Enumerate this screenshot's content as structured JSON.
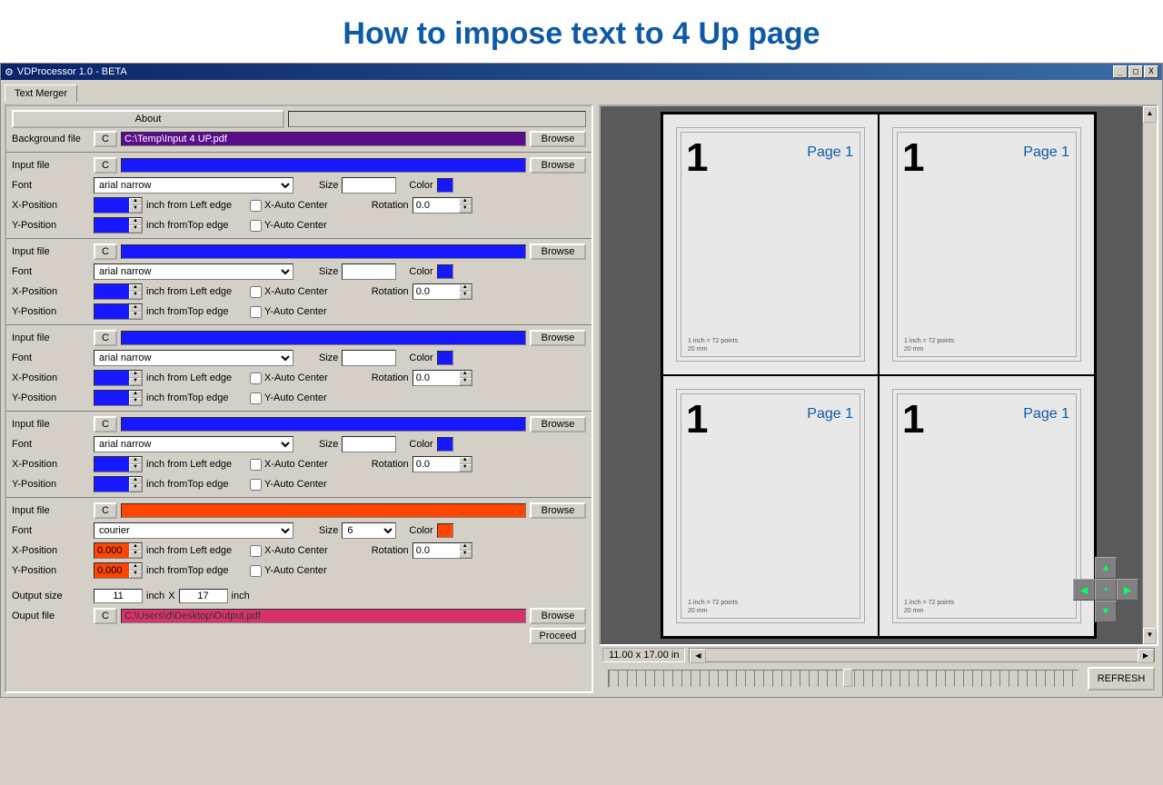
{
  "page_heading": "How to impose text to 4 Up page",
  "window_title": "VDProcessor 1.0 - BETA",
  "tab": "Text Merger",
  "about_label": "About",
  "browse_label": "Browse",
  "c_label": "C",
  "background": {
    "label": "Background file",
    "path": "C:\\Temp\\Input 4 UP.pdf"
  },
  "common": {
    "input_label": "Input file",
    "font_label": "Font",
    "size_label": "Size",
    "color_label": "Color",
    "xpos_label": "X-Position",
    "ypos_label": "Y-Position",
    "from_left": "inch from Left edge",
    "from_top": "inch fromTop edge",
    "x_auto": "X-Auto Center",
    "y_auto": "Y-Auto Center",
    "rotation_label": "Rotation"
  },
  "blocks": [
    {
      "font": "arial narrow",
      "rotation": "0.0",
      "color_class": "sw-blue",
      "field_class": "input-blue"
    },
    {
      "font": "arial narrow",
      "rotation": "0.0",
      "color_class": "sw-blue",
      "field_class": "input-blue"
    },
    {
      "font": "arial narrow",
      "rotation": "0.0",
      "color_class": "sw-blue",
      "field_class": "input-blue"
    },
    {
      "font": "arial narrow",
      "rotation": "0.0",
      "color_class": "sw-blue",
      "field_class": "input-blue"
    },
    {
      "font": "courier",
      "size": "6",
      "xpos": "0.000",
      "ypos": "0.000",
      "rotation": "0.0",
      "color_class": "sw-orange",
      "field_class": "input-orange"
    }
  ],
  "output_size": {
    "label": "Output size",
    "w": "11",
    "h": "17",
    "inch": "inch",
    "x": "X"
  },
  "output_file": {
    "label": "Ouput file",
    "path": "C:\\Users\\d\\Desktop\\Output.pdf"
  },
  "proceed_label": "Proceed",
  "refresh_label": "REFRESH",
  "preview": {
    "dim": "11.00 x 17.00 in",
    "big_num": "1",
    "page_label": "Page 1",
    "ruler1": "1 inch = 72 points",
    "ruler2": "20 mm"
  }
}
